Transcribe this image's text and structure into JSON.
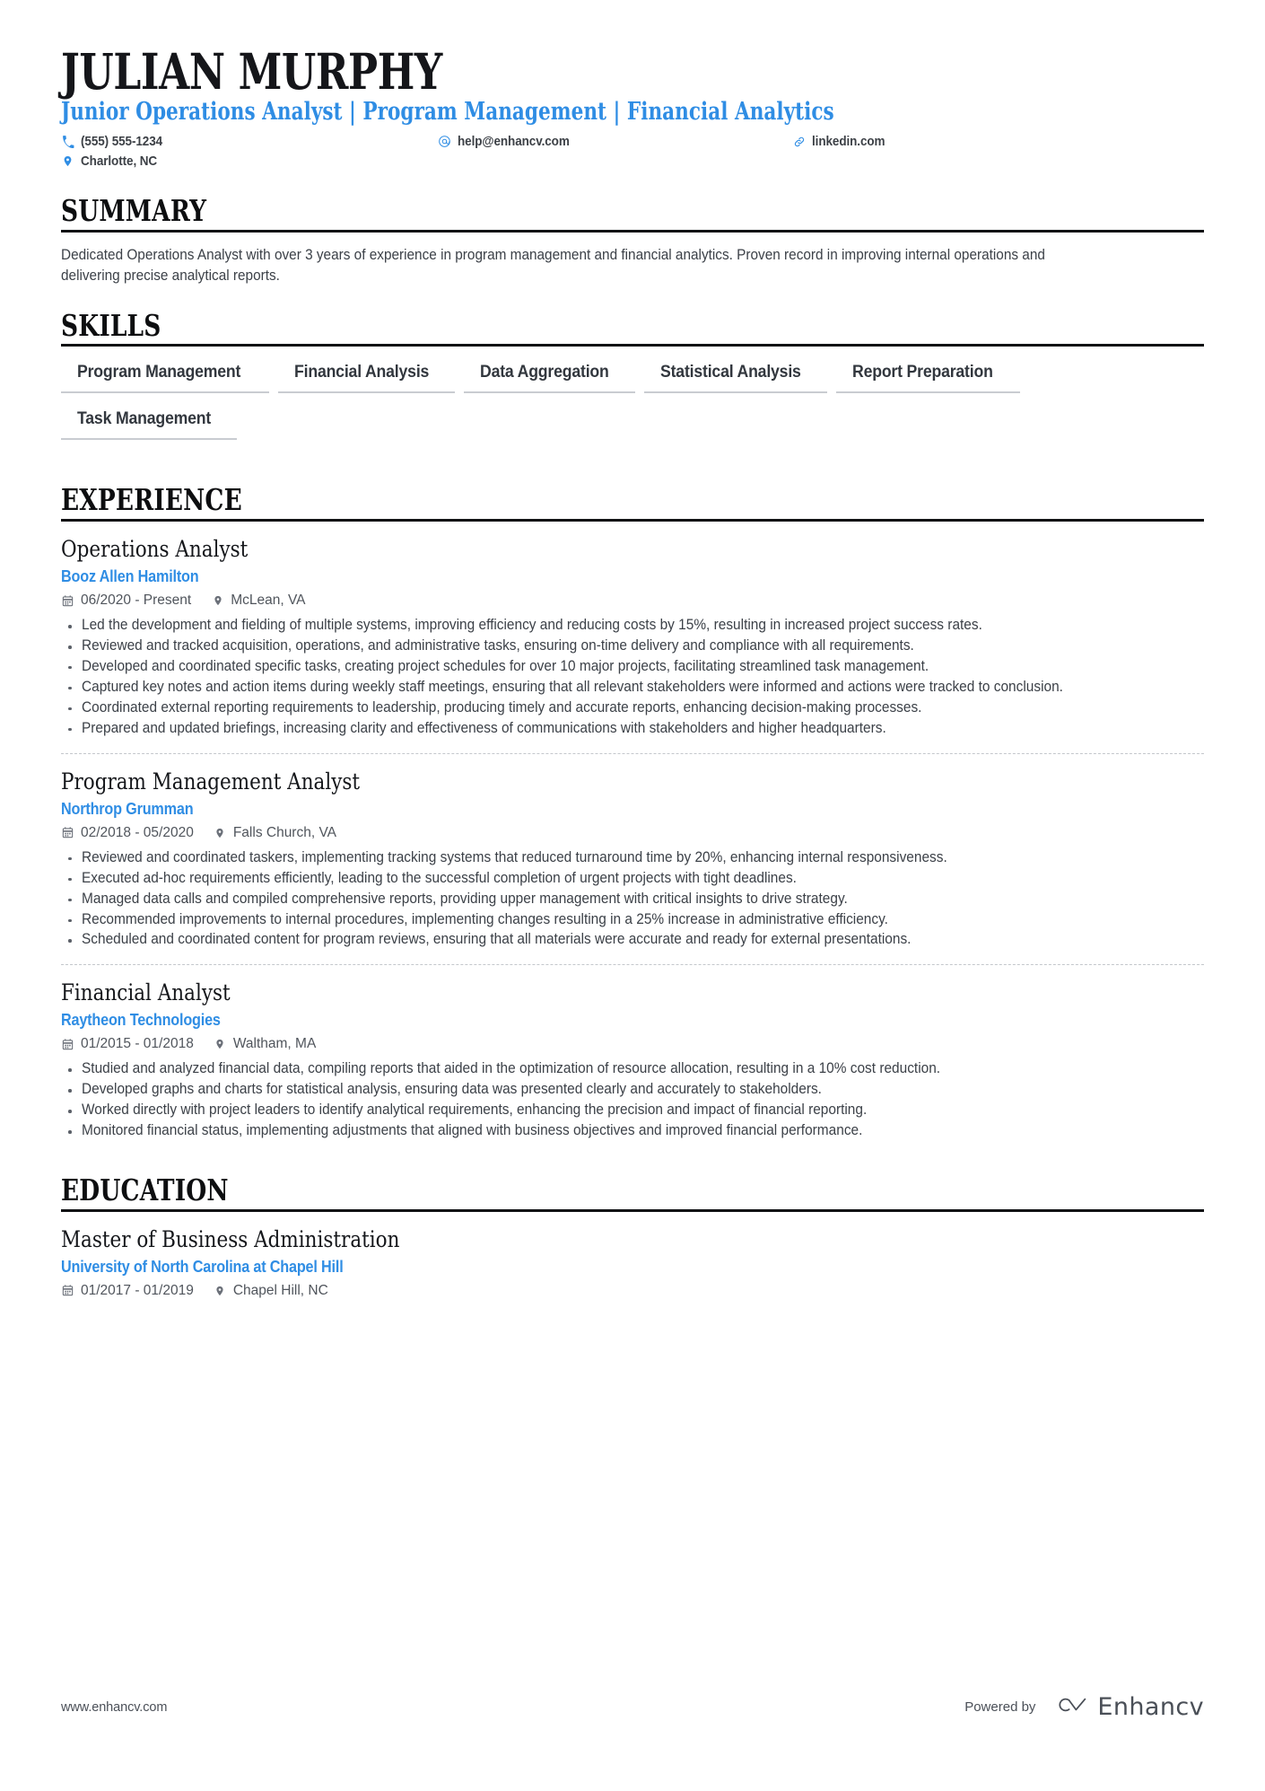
{
  "header": {
    "name": "JULIAN MURPHY",
    "headline": "Junior Operations Analyst | Program Management | Financial Analytics",
    "contacts": [
      {
        "icon": "phone-icon",
        "text": "(555) 555-1234"
      },
      {
        "icon": "email-icon",
        "text": "help@enhancv.com"
      },
      {
        "icon": "link-icon",
        "text": "linkedin.com"
      },
      {
        "icon": "location-pin-icon",
        "text": "Charlotte, NC"
      }
    ]
  },
  "summary": {
    "title": "SUMMARY",
    "text": "Dedicated Operations Analyst with over 3 years of experience in program management and financial analytics. Proven record in improving internal operations and delivering precise analytical reports."
  },
  "skills": {
    "title": "SKILLS",
    "items": [
      "Program Management",
      "Financial Analysis",
      "Data Aggregation",
      "Statistical Analysis",
      "Report Preparation",
      "Task Management"
    ]
  },
  "experience": {
    "title": "EXPERIENCE",
    "entries": [
      {
        "title": "Operations Analyst",
        "org": "Booz Allen Hamilton",
        "dates": "06/2020 - Present",
        "location": "McLean, VA",
        "bullets": [
          "Led the development and fielding of multiple systems, improving efficiency and reducing costs by 15%, resulting in increased project success rates.",
          "Reviewed and tracked acquisition, operations, and administrative tasks, ensuring on-time delivery and compliance with all requirements.",
          "Developed and coordinated specific tasks, creating project schedules for over 10 major projects, facilitating streamlined task management.",
          "Captured key notes and action items during weekly staff meetings, ensuring that all relevant stakeholders were informed and actions were tracked to conclusion.",
          "Coordinated external reporting requirements to leadership, producing timely and accurate reports, enhancing decision-making processes.",
          "Prepared and updated briefings, increasing clarity and effectiveness of communications with stakeholders and higher headquarters."
        ]
      },
      {
        "title": "Program Management Analyst",
        "org": "Northrop Grumman",
        "dates": "02/2018 - 05/2020",
        "location": "Falls Church, VA",
        "bullets": [
          "Reviewed and coordinated taskers, implementing tracking systems that reduced turnaround time by 20%, enhancing internal responsiveness.",
          "Executed ad-hoc requirements efficiently, leading to the successful completion of urgent projects with tight deadlines.",
          "Managed data calls and compiled comprehensive reports, providing upper management with critical insights to drive strategy.",
          "Recommended improvements to internal procedures, implementing changes resulting in a 25% increase in administrative efficiency.",
          "Scheduled and coordinated content for program reviews, ensuring that all materials were accurate and ready for external presentations."
        ]
      },
      {
        "title": "Financial Analyst",
        "org": "Raytheon Technologies",
        "dates": "01/2015 - 01/2018",
        "location": "Waltham, MA",
        "bullets": [
          "Studied and analyzed financial data, compiling reports that aided in the optimization of resource allocation, resulting in a 10% cost reduction.",
          "Developed graphs and charts for statistical analysis, ensuring data was presented clearly and accurately to stakeholders.",
          "Worked directly with project leaders to identify analytical requirements, enhancing the precision and impact of financial reporting.",
          "Monitored financial status, implementing adjustments that aligned with business objectives and improved financial performance."
        ]
      }
    ]
  },
  "education": {
    "title": "EDUCATION",
    "entries": [
      {
        "title": "Master of Business Administration",
        "org": "University of North Carolina at Chapel Hill",
        "dates": "01/2017 - 01/2019",
        "location": "Chapel Hill, NC"
      }
    ]
  },
  "footer": {
    "url": "www.enhancv.com",
    "powered_by": "Powered by",
    "brand": "Enhancv"
  },
  "colors": {
    "accent_blue": "#2f8de4",
    "text_dark": "#14161a",
    "text_body": "#3c4148",
    "rule": "#111214",
    "chip_underline": "#c9ccd1"
  }
}
